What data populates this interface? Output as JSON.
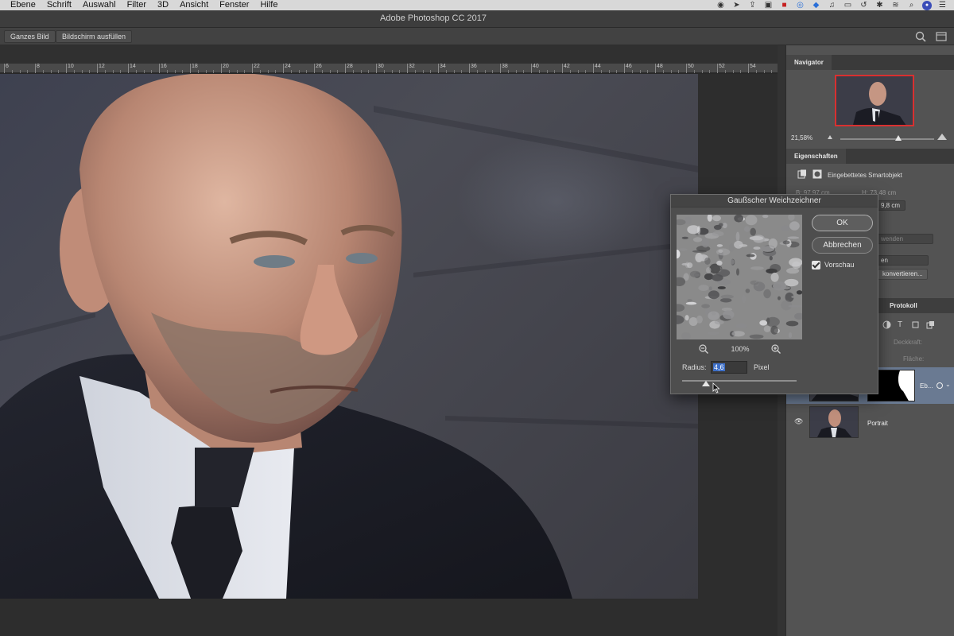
{
  "menubar": {
    "items": [
      "Ebene",
      "Schrift",
      "Auswahl",
      "Filter",
      "3D",
      "Ansicht",
      "Fenster",
      "Hilfe"
    ],
    "tray_icons": [
      "record-icon",
      "arrow-icon",
      "share-icon",
      "notification-icon",
      "red-app-icon",
      "quicksilver-icon",
      "dropbox-icon",
      "bell-icon",
      "airplay-icon",
      "time-machine-icon",
      "bluetooth-icon",
      "wifi-icon",
      "spotlight-icon",
      "user-avatar-icon",
      "menu-icon"
    ]
  },
  "window": {
    "title": "Adobe Photoshop CC 2017"
  },
  "options_bar": {
    "fit_button": "Ganzes Bild",
    "fill_button": "Bildschirm ausfüllen"
  },
  "ruler": {
    "ticks": [
      "6",
      "8",
      "10",
      "12",
      "14",
      "16",
      "18",
      "20",
      "22",
      "24",
      "26",
      "28",
      "30",
      "32",
      "34",
      "36",
      "38",
      "40",
      "42",
      "44",
      "46",
      "48",
      "50",
      "52",
      "54"
    ]
  },
  "navigator": {
    "tab": "Navigator",
    "zoom": "21,58%",
    "zoom_slider": 0.62
  },
  "properties": {
    "tab": "Eigenschaften",
    "object_type": "Eingebettetes Smartobjekt",
    "width": "B: 97,97 cm",
    "height": "H: 73,48 cm",
    "height_field": "9,8 cm",
    "field_a": "wenden",
    "field_b": "en",
    "convert_button": "konvertieren..."
  },
  "layers": {
    "tab": "Protokoll",
    "opacity_label": "Deckkraft:",
    "fill_label": "Fläche:",
    "selected_layer_name": "Eb...",
    "portrait_layer_name": "Portrait"
  },
  "dialog": {
    "title": "Gaußscher Weichzeichner",
    "ok": "OK",
    "cancel": "Abbrechen",
    "preview_label": "Vorschau",
    "preview_checked": true,
    "zoom": "100%",
    "radius_label": "Radius:",
    "radius_value": "4,6",
    "unit": "Pixel",
    "slider_value": 0.21
  },
  "colors": {
    "accent_selection": "#3d6fc8",
    "navigator_frame": "#d93030",
    "selected_layer": "#6a7a92"
  }
}
